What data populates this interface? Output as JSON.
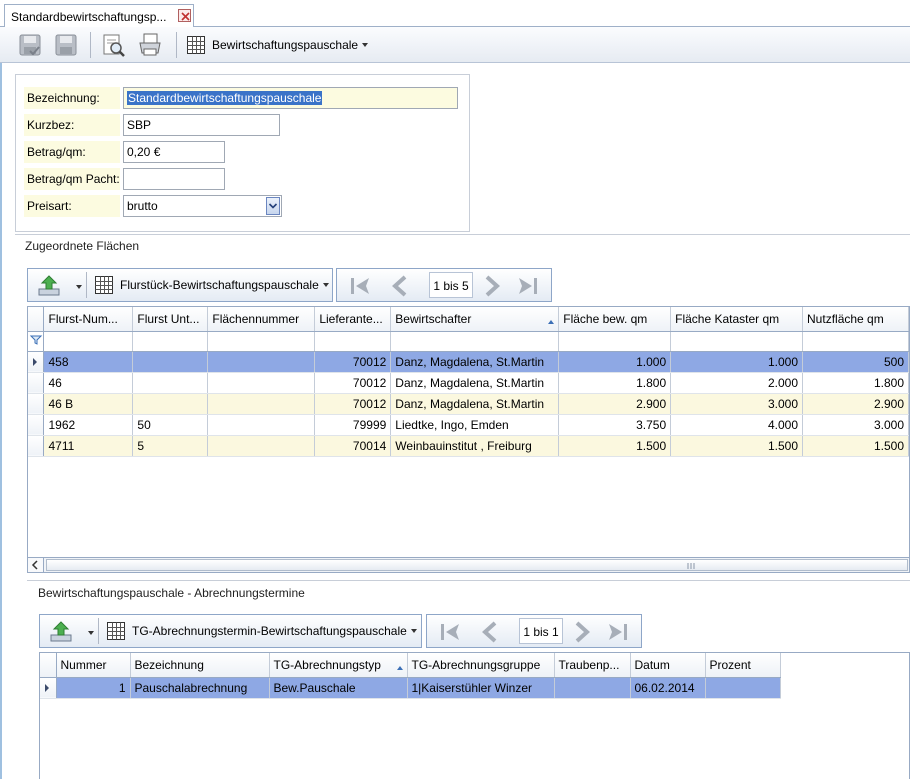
{
  "tab": {
    "title": "Standardbewirtschaftungsp..."
  },
  "toolbar": {
    "dropdown_label": "Bewirtschaftungspauschale"
  },
  "form": {
    "bezeichnung_label": "Bezeichnung:",
    "bezeichnung_value": "Standardbewirtschaftungspauschale",
    "kurzbez_label": "Kurzbez:",
    "kurzbez_value": "SBP",
    "betrag_label": "Betrag/qm:",
    "betrag_value": "0,20 €",
    "betrag_pacht_label": "Betrag/qm Pacht:",
    "betrag_pacht_value": "",
    "preisart_label": "Preisart:",
    "preisart_value": "brutto"
  },
  "flaechen": {
    "section_title": "Zugeordnete Flächen",
    "layout_label": "Flurstück-Bewirtschaftungspauschale",
    "pager_label": "1 bis 5",
    "columns": [
      "Flurst-Num...",
      "Flurst Unt...",
      "Flächennummer",
      "Lieferante...",
      "Bewirtschafter",
      "Fläche bew. qm",
      "Fläche Kataster qm",
      "Nutzfläche qm"
    ],
    "rows": [
      [
        "458",
        "",
        "",
        "70012",
        "Danz, Magdalena, St.Martin",
        "1.000",
        "1.000",
        "500"
      ],
      [
        "46",
        "",
        "",
        "70012",
        "Danz, Magdalena, St.Martin",
        "1.800",
        "2.000",
        "1.800"
      ],
      [
        "46 B",
        "",
        "",
        "70012",
        "Danz, Magdalena, St.Martin",
        "2.900",
        "3.000",
        "2.900"
      ],
      [
        "1962",
        "50",
        "",
        "79999",
        "Liedtke, Ingo, Emden",
        "3.750",
        "4.000",
        "3.000"
      ],
      [
        "4711",
        "5",
        "",
        "70014",
        "Weinbauinstitut , Freiburg",
        "1.500",
        "1.500",
        "1.500"
      ]
    ]
  },
  "termine": {
    "section_title": "Bewirtschaftungspauschale - Abrechnungstermine",
    "layout_label": "TG-Abrechnungstermin-Bewirtschaftungspauschale",
    "pager_label": "1 bis 1",
    "columns": [
      "Nummer",
      "Bezeichnung",
      "TG-Abrechnungstyp",
      "TG-Abrechnungsgruppe",
      "Traubenp...",
      "Datum",
      "Prozent"
    ],
    "rows": [
      [
        "1",
        "Pauschalabrechnung",
        "Bew.Pauschale",
        "1|Kaiserstühler Winzer",
        "",
        "06.02.2014",
        ""
      ]
    ]
  },
  "colors": {
    "selection_row": "#8ea8e4",
    "alt_row": "#fbf8df",
    "label_bg": "#fcfbe0",
    "accent": "#3a73c8"
  }
}
